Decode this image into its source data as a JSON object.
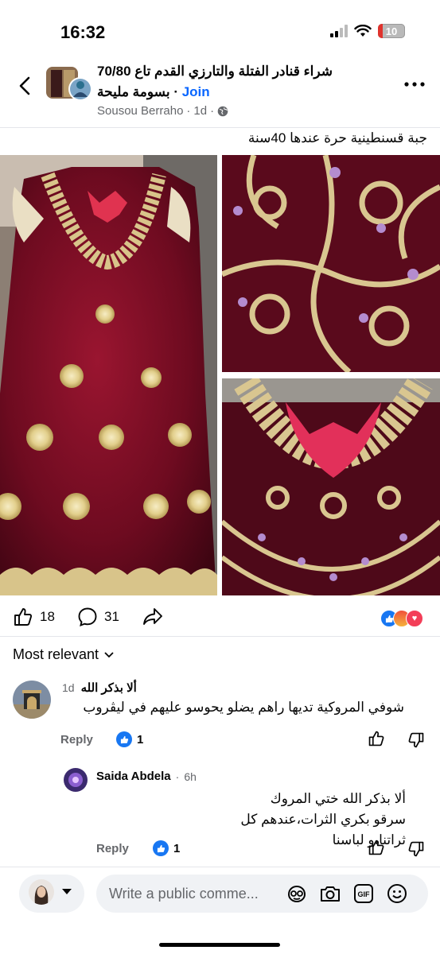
{
  "status_bar": {
    "time": "16:32",
    "battery": "10"
  },
  "header": {
    "group_name": "شراء قنادر الفتلة والتارزي القدم تاع 70/80",
    "group_name_2": "بسومة مليحة",
    "join_label": "Join",
    "separator": "·",
    "author": "Sousou Berraho",
    "time": "1d",
    "audience_icon": "globe-icon"
  },
  "post": {
    "text": "جبة قسنطينية حرة عندها 40سنة",
    "like_count": "18",
    "comment_count": "31"
  },
  "comments_header": {
    "sort_label": "Most relevant"
  },
  "comments": [
    {
      "time": "1d",
      "author": "ألا بذكر الله",
      "text": "شوفي المروكية تديها راهم يضلو يحوسو عليهم في ليڤروب",
      "reply_label": "Reply",
      "likes": "1"
    },
    {
      "author": "Saida Abdela",
      "time": "6h",
      "text": "ألا بذكر الله ختي المروك سرقو بكري الثرات،عندهم كل ثراتنا،و لباسنا",
      "reply_label": "Reply",
      "likes": "1"
    }
  ],
  "composer": {
    "placeholder": "Write a public comme..."
  },
  "colors": {
    "accent": "#0866ff",
    "like_blue": "#1877f2",
    "velvet": "#6b0a1e",
    "gold": "#d8c48a"
  }
}
